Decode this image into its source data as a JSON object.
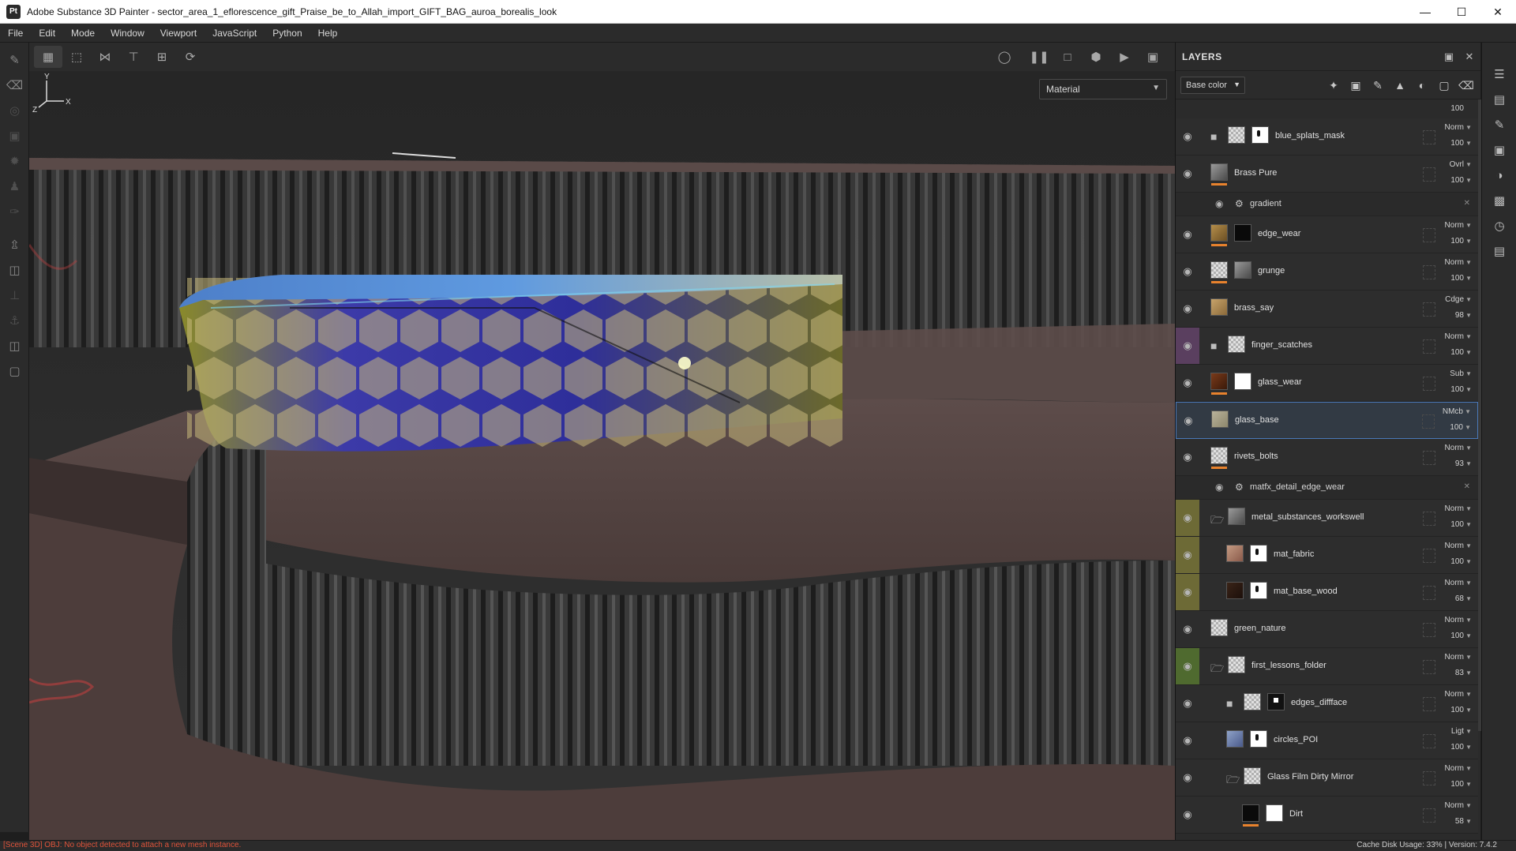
{
  "window": {
    "logo": "Pt",
    "title": "Adobe Substance 3D Painter - sector_area_1_eflorescence_gift_Praise_be_to_Allah_import_GIFT_BAG_auroa_borealis_look",
    "controls": [
      "minimize-icon",
      "maximize-icon",
      "close-icon"
    ]
  },
  "menu": [
    "File",
    "Edit",
    "Mode",
    "Window",
    "Viewport",
    "JavaScript",
    "Python",
    "Help"
  ],
  "viewport": {
    "mode": "Material",
    "axis": {
      "x": "X",
      "y": "Y",
      "z": "Z"
    }
  },
  "layers_panel": {
    "title": "LAYERS",
    "channel": "Base color",
    "top_opacity": "100",
    "rows": [
      {
        "kind": "layer",
        "name": "blue_splats_mask",
        "blend": "Norm",
        "opacity": "100",
        "folder": true,
        "indent": 0,
        "thumb": "checker",
        "mask": "mask-spot",
        "eye": "normal"
      },
      {
        "kind": "layer",
        "name": "Brass Pure",
        "blend": "Ovrl",
        "opacity": "100",
        "folder": false,
        "indent": 0,
        "thumb": "grayimg",
        "mask": null,
        "eye": "normal",
        "bar": true
      },
      {
        "kind": "effect",
        "name": "gradient"
      },
      {
        "kind": "layer",
        "name": "edge_wear",
        "blend": "Norm",
        "opacity": "100",
        "folder": false,
        "indent": 0,
        "thumb": "brass",
        "mask": "black",
        "eye": "normal",
        "bar": true
      },
      {
        "kind": "layer",
        "name": "grunge",
        "blend": "Norm",
        "opacity": "100",
        "folder": false,
        "indent": 0,
        "thumb": "checker",
        "mask": "grayimg",
        "eye": "normal",
        "bar": true
      },
      {
        "kind": "layer",
        "name": "brass_say",
        "blend": "Cdge",
        "opacity": "98",
        "folder": false,
        "indent": 0,
        "thumb": "tan",
        "mask": null,
        "eye": "normal"
      },
      {
        "kind": "layer",
        "name": "finger_scatches",
        "blend": "Norm",
        "opacity": "100",
        "folder": true,
        "indent": 0,
        "thumb": "checker",
        "mask": null,
        "eye": "purple"
      },
      {
        "kind": "layer",
        "name": "glass_wear",
        "blend": "Sub",
        "opacity": "100",
        "folder": false,
        "indent": 0,
        "thumb": "brown",
        "mask": "white",
        "eye": "normal",
        "bar": true
      },
      {
        "kind": "layer",
        "name": "glass_base",
        "blend": "NMcb",
        "opacity": "100",
        "folder": false,
        "indent": 0,
        "thumb": "glass",
        "mask": null,
        "eye": "normal",
        "selected": true
      },
      {
        "kind": "layer",
        "name": "rivets_bolts",
        "blend": "Norm",
        "opacity": "93",
        "folder": false,
        "indent": 0,
        "thumb": "checker",
        "mask": null,
        "eye": "normal",
        "bar": true
      },
      {
        "kind": "effect",
        "name": "matfx_detail_edge_wear"
      },
      {
        "kind": "layer",
        "name": "metal_substances_workswell",
        "blend": "Norm",
        "opacity": "100",
        "folder": true,
        "open": true,
        "indent": 0,
        "thumb": "grayimg",
        "mask": null,
        "eye": "olive"
      },
      {
        "kind": "layer",
        "name": "mat_fabric",
        "blend": "Norm",
        "opacity": "100",
        "folder": false,
        "indent": 1,
        "thumb": "fabric",
        "mask": "mask-spot",
        "eye": "olive"
      },
      {
        "kind": "layer",
        "name": "mat_base_wood",
        "blend": "Norm",
        "opacity": "68",
        "folder": false,
        "indent": 1,
        "thumb": "wood",
        "mask": "mask-spot",
        "eye": "olive"
      },
      {
        "kind": "layer",
        "name": "green_nature",
        "blend": "Norm",
        "opacity": "100",
        "folder": false,
        "indent": 0,
        "thumb": "checker",
        "mask": null,
        "eye": "normal"
      },
      {
        "kind": "layer",
        "name": "first_lessons_folder",
        "blend": "Norm",
        "opacity": "83",
        "folder": true,
        "open": true,
        "indent": 0,
        "thumb": "checker",
        "mask": null,
        "eye": "green"
      },
      {
        "kind": "layer",
        "name": "edges_diffface",
        "blend": "Norm",
        "opacity": "100",
        "folder": true,
        "indent": 1,
        "thumb": "checker",
        "mask": "mask-black-spots",
        "eye": "normal"
      },
      {
        "kind": "layer",
        "name": "circles_POI",
        "blend": "Ligt",
        "opacity": "100",
        "folder": false,
        "indent": 1,
        "thumb": "blueimg",
        "mask": "mask-spot",
        "eye": "normal"
      },
      {
        "kind": "layer",
        "name": "Glass Film Dirty Mirror",
        "blend": "Norm",
        "opacity": "100",
        "folder": true,
        "open": true,
        "indent": 1,
        "thumb": "checker",
        "mask": null,
        "eye": "normal"
      },
      {
        "kind": "layer",
        "name": "Dirt",
        "blend": "Norm",
        "opacity": "58",
        "folder": false,
        "indent": 2,
        "thumb": "black",
        "mask": "white",
        "eye": "normal",
        "bar": true
      }
    ]
  },
  "status": {
    "message": "[Scene 3D] OBJ: No object detected to attach a new mesh instance.",
    "right": "Cache Disk Usage:   33% | Version: 7.4.2"
  },
  "colors": {
    "accent": "#e8822d",
    "selection": "#4a78b8",
    "error_text": "#e0533a"
  }
}
